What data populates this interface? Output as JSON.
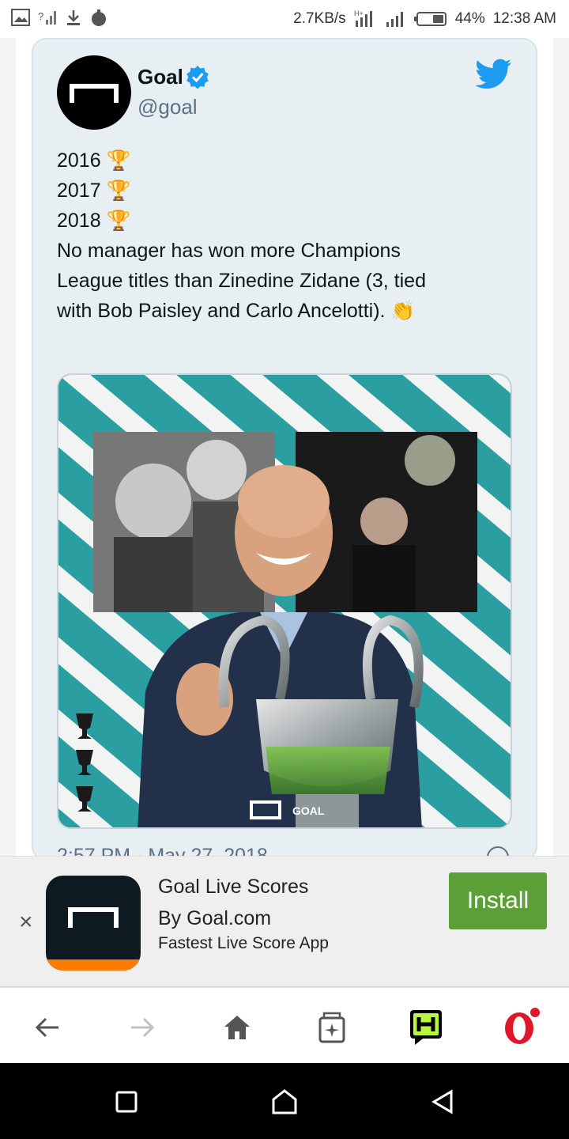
{
  "status_bar": {
    "speed": "2.7KB/s",
    "battery": "44%",
    "time": "12:38 AM"
  },
  "tweet": {
    "name": "Goal",
    "handle": "@goal",
    "lines": [
      "2016 🏆",
      "2017 🏆",
      "2018 🏆",
      "",
      "No manager has won more Champions",
      "League titles than Zinedine Zidane (3, tied",
      "with Bob Paisley and Carlo Ancelotti). 👏"
    ],
    "timestamp": "2:57 PM · May 27, 2018",
    "image_watermark": "GOAL"
  },
  "ad": {
    "title": "Goal Live Scores",
    "by": "By Goal.com",
    "desc": "Fastest Live Score App",
    "install_label": "Install",
    "close": "×"
  },
  "colors": {
    "accent_twitter": "#1d9bf0",
    "install_green": "#5aa036",
    "opera_red": "#e0162b",
    "goal_orange": "#ff7a00"
  }
}
